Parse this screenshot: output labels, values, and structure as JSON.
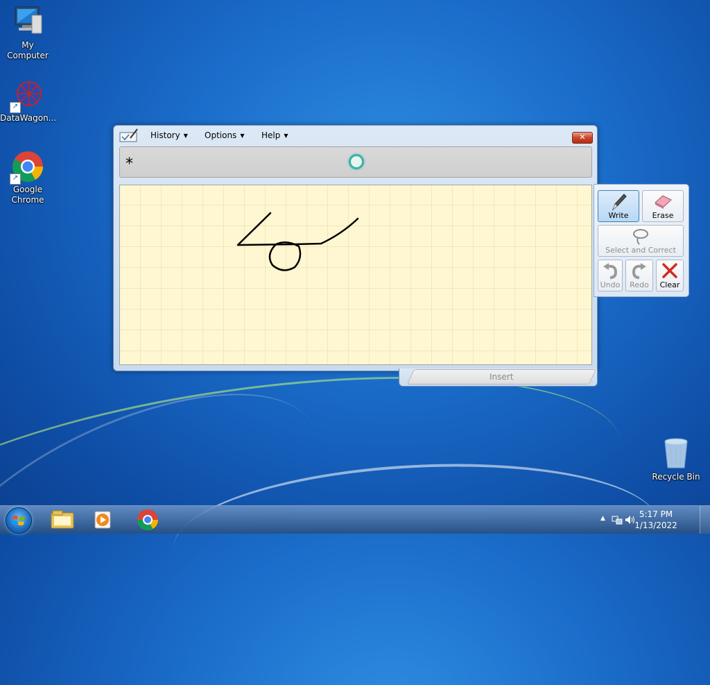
{
  "desktop": {
    "icons": [
      {
        "label": "My Computer",
        "icon": "computer-icon"
      },
      {
        "label": "DataWagon...",
        "icon": "datawagon-icon"
      },
      {
        "label": "Google Chrome",
        "icon": "chrome-icon"
      },
      {
        "label": "Recycle Bin",
        "icon": "recycle-bin-icon"
      }
    ]
  },
  "ink_window": {
    "menus": [
      "History",
      "Options",
      "Help"
    ],
    "close_label": "✕",
    "preview_text": "*",
    "insert_label": "Insert"
  },
  "tools": {
    "write": "Write",
    "erase": "Erase",
    "select_correct": "Select and Correct",
    "undo": "Undo",
    "redo": "Redo",
    "clear": "Clear"
  },
  "taskbar": {
    "pinned": [
      "explorer-icon",
      "media-player-icon",
      "chrome-icon"
    ],
    "time": "5:17 PM",
    "date": "1/13/2022"
  },
  "colors": {
    "accent": "#3c7fb1",
    "canvas": "#fff7d2",
    "close": "#c9462c"
  }
}
